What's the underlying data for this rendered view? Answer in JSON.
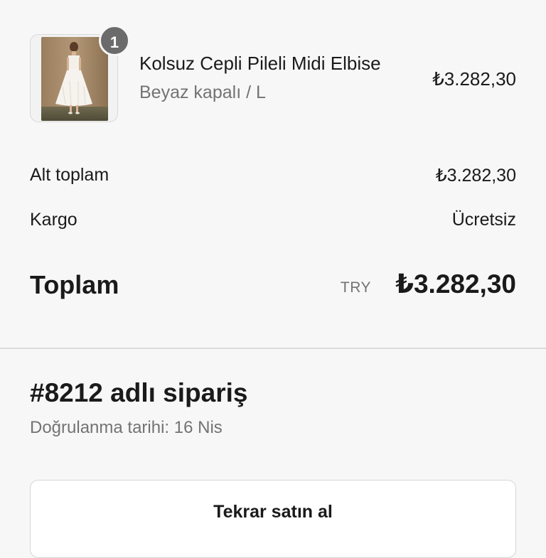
{
  "cart": {
    "item": {
      "quantity": "1",
      "name": "Kolsuz Cepli Pileli Midi Elbise",
      "variant": "Beyaz kapalı / L",
      "price": "₺3.282,30"
    }
  },
  "summary": {
    "subtotal_label": "Alt toplam",
    "subtotal_value": "₺3.282,30",
    "shipping_label": "Kargo",
    "shipping_value": "Ücretsiz",
    "total_label": "Toplam",
    "total_currency": "TRY",
    "total_value": "₺3.282,30"
  },
  "order": {
    "title": "#8212 adlı sipariş",
    "confirmed": "Doğrulanma tarihi: 16 Nis"
  },
  "actions": {
    "rebuy_label": "Tekrar satın al"
  },
  "colors": {
    "background": "#f7f7f7",
    "text": "#1a1a1a",
    "muted": "#737373",
    "badge": "#6b6b6b",
    "divider": "#dcdcdc"
  }
}
